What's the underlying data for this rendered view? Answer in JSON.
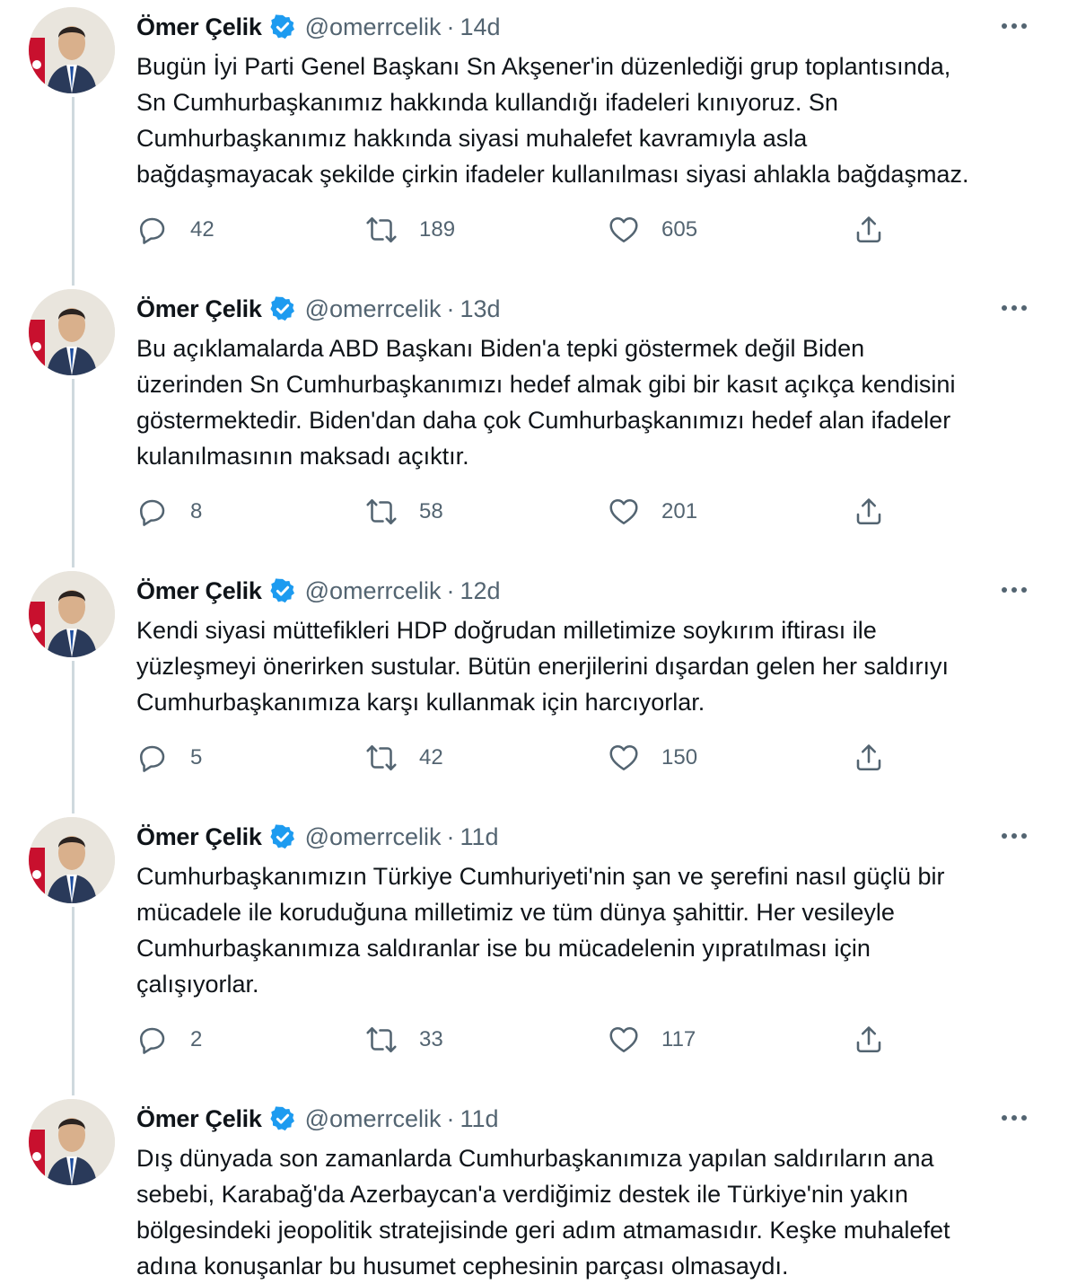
{
  "colors": {
    "text": "#0f1419",
    "secondary": "#536471",
    "verified": "#1d9bf0",
    "thread_line": "#cfd9de"
  },
  "icons": {
    "verified": "verified-badge-icon",
    "more": "more-horizontal-icon",
    "reply": "reply-icon",
    "retweet": "retweet-icon",
    "like": "heart-icon",
    "share": "share-icon"
  },
  "tweets": [
    {
      "author": "Ömer Çelik",
      "handle": "@omerrcelik",
      "separator": "·",
      "time": "14d",
      "lines": [
        "Bugün İyi Parti Genel Başkanı Sn Akşener'in düzenlediği grup toplantısında,",
        "Sn Cumhurbaşkanımız hakkında kullandığı ifadeleri kınıyoruz. Sn",
        "Cumhurbaşkanımız hakkında siyasi muhalefet kavramıyla asla",
        "bağdaşmayacak şekilde çirkin ifadeler kullanılması siyasi ahlakla bağdaşmaz."
      ],
      "replies": "42",
      "retweets": "189",
      "likes": "605"
    },
    {
      "author": "Ömer Çelik",
      "handle": "@omerrcelik",
      "separator": "·",
      "time": "13d",
      "lines": [
        "Bu açıklamalarda ABD Başkanı Biden'a tepki göstermek değil Biden",
        "üzerinden Sn Cumhurbaşkanımızı hedef almak gibi bir kasıt açıkça kendisini",
        "göstermektedir. Biden'dan daha çok Cumhurbaşkanımızı hedef alan ifadeler",
        "kulanılmasının maksadı açıktır."
      ],
      "replies": "8",
      "retweets": "58",
      "likes": "201"
    },
    {
      "author": "Ömer Çelik",
      "handle": "@omerrcelik",
      "separator": "·",
      "time": "12d",
      "lines": [
        "Kendi siyasi müttefikleri HDP doğrudan milletimize soykırım iftirası ile",
        "yüzleşmeyi önerirken sustular. Bütün enerjilerini dışardan gelen her saldırıyı",
        "Cumhurbaşkanımıza karşı kullanmak için harcıyorlar."
      ],
      "replies": "5",
      "retweets": "42",
      "likes": "150"
    },
    {
      "author": "Ömer Çelik",
      "handle": "@omerrcelik",
      "separator": "·",
      "time": "11d",
      "lines": [
        "Cumhurbaşkanımızın Türkiye Cumhuriyeti'nin şan ve şerefini nasıl güçlü bir",
        "mücadele ile koruduğuna milletimiz ve tüm dünya şahittir. Her vesileyle",
        "Cumhurbaşkanımıza saldıranlar ise bu mücadelenin yıpratılması için",
        "çalışıyorlar."
      ],
      "replies": "2",
      "retweets": "33",
      "likes": "117"
    },
    {
      "author": "Ömer Çelik",
      "handle": "@omerrcelik",
      "separator": "·",
      "time": "11d",
      "lines": [
        "Dış dünyada son zamanlarda Cumhurbaşkanımıza yapılan saldırıların ana",
        "sebebi, Karabağ'da Azerbaycan'a verdiğimiz destek ile Türkiye'nin yakın",
        "bölgesindeki jeopolitik stratejisinde geri adım atmamasıdır. Keşke muhalefet",
        "adına konuşanlar bu husumet cephesinin parçası olmasaydı."
      ]
    }
  ]
}
